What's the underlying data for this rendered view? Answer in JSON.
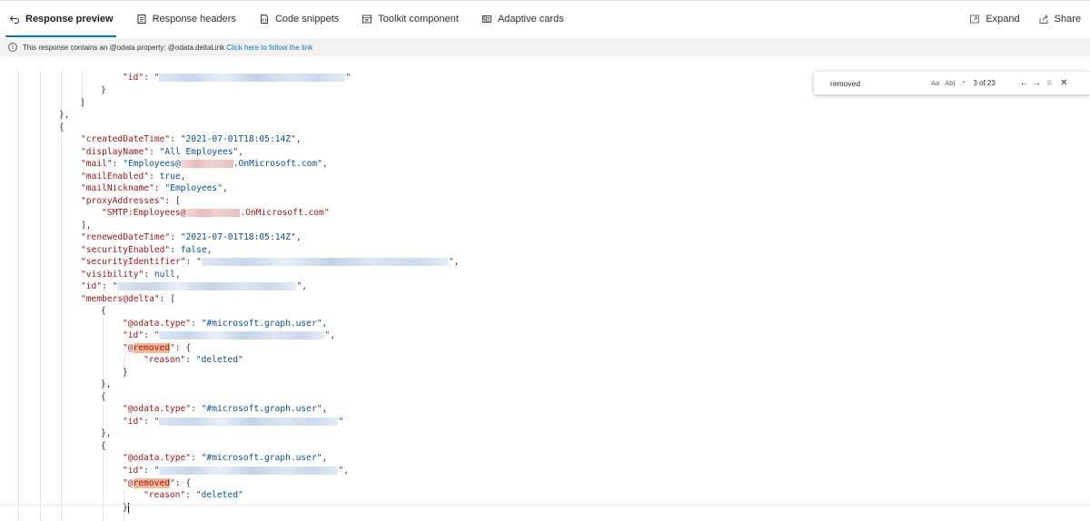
{
  "tabs": [
    {
      "label": "Response preview",
      "icon": "undo-arrow-icon",
      "active": true
    },
    {
      "label": "Response headers",
      "icon": "document-icon",
      "active": false
    },
    {
      "label": "Code snippets",
      "icon": "code-file-icon",
      "active": false
    },
    {
      "label": "Toolkit component",
      "icon": "component-icon",
      "active": false
    },
    {
      "label": "Adaptive cards",
      "icon": "card-icon",
      "active": false
    }
  ],
  "actions": {
    "expand": "Expand",
    "share": "Share"
  },
  "infobar": {
    "message": "This response contains an @odata property: @odata.deltaLink",
    "link": "Click here to follow the link"
  },
  "find": {
    "value": "removed",
    "match_case": "Aa",
    "whole_word": "Ab|",
    "regex": ".*",
    "count": "3 of 23"
  },
  "code": {
    "l01_key": "\"id\"",
    "l01_open": "\"",
    "l01_close": "\"",
    "l02": "}",
    "l03": "]",
    "l04": "},",
    "l05": "{",
    "l06_key": "\"createdDateTime\"",
    "l06_val": "\"2021-07-01T18:05:14Z\"",
    "l07_key": "\"displayName\"",
    "l07_val": "\"All Employees\"",
    "l08_key": "\"mail\"",
    "l08_pre": "\"Employees@",
    "l08_post": ".OnMicrosoft.com\"",
    "l09_key": "\"mailEnabled\"",
    "l09_val": "true",
    "l10_key": "\"mailNickname\"",
    "l10_val": "\"Employees\"",
    "l11_key": "\"proxyAddresses\"",
    "l11_val": "[",
    "l12_pre": "\"SMTP:Employees@",
    "l12_post": ".OnMicrosoft.com\"",
    "l13": "],",
    "l14_key": "\"renewedDateTime\"",
    "l14_val": "\"2021-07-01T18:05:14Z\"",
    "l15_key": "\"securityEnabled\"",
    "l15_val": "false",
    "l16_key": "\"securityIdentifier\"",
    "l16_open": "\"",
    "l16_close": "\"",
    "l17_key": "\"visibility\"",
    "l17_val": "null",
    "l18_key": "\"id\"",
    "l18_open": "\"",
    "l18_close": "\"",
    "l19_key": "\"members@delta\"",
    "l19_val": "[",
    "l20": "{",
    "l21_key": "\"@odata.type\"",
    "l21_val": "\"#microsoft.graph.user\"",
    "l22_key": "\"id\"",
    "l22_open": "\"",
    "l22_close": "\"",
    "l23_pre": "\"@",
    "l23_hl": "removed",
    "l23_post": "\"",
    "l23_val": "{",
    "l24_key": "\"reason\"",
    "l24_val": "\"deleted\"",
    "l25": "}",
    "l26": "},",
    "l27": "{",
    "l28_key": "\"@odata.type\"",
    "l28_val": "\"#microsoft.graph.user\"",
    "l29_key": "\"id\"",
    "l29_open": "\"",
    "l29_close": "\"",
    "l30": "},",
    "l31": "{",
    "l32_key": "\"@odata.type\"",
    "l32_val": "\"#microsoft.graph.user\"",
    "l33_key": "\"id\"",
    "l33_open": "\"",
    "l33_close": "\"",
    "l34_pre": "\"@",
    "l34_hl": "removed",
    "l34_post": "\"",
    "l34_val": "{",
    "l35_key": "\"reason\"",
    "l35_val": "\"deleted\"",
    "l36": "}"
  }
}
